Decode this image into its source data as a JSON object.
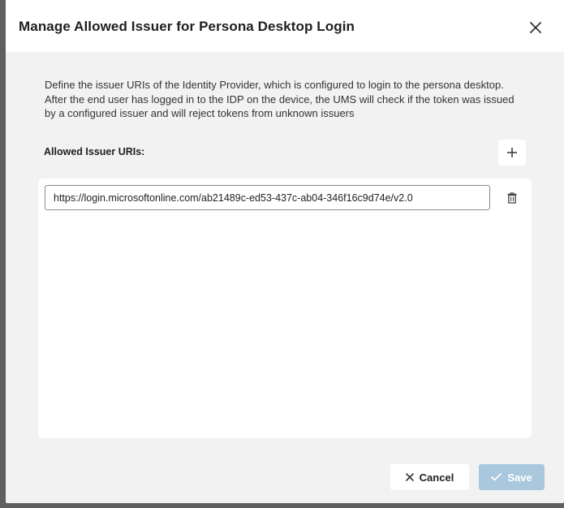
{
  "dialog": {
    "title": "Manage Allowed Issuer for Persona Desktop Login",
    "description": "Define the issuer URIs of the Identity Provider, which is configured to login to the persona desktop. After the end user has logged in to the IDP on the device, the UMS will check if the token was issued by a configured issuer and will reject tokens from unknown issuers",
    "section_label": "Allowed Issuer URIs:",
    "issuers": [
      {
        "value": "https://login.microsoftonline.com/ab21489c-ed53-437c-ab04-346f16c9d74e/v2.0"
      }
    ],
    "icons": {
      "close": "close-icon",
      "add": "plus-icon",
      "delete": "trash-icon",
      "cancel": "x-icon",
      "save": "check-icon"
    }
  },
  "footer": {
    "cancel_label": "Cancel",
    "save_label": "Save"
  },
  "colors": {
    "save_disabled": "#a9c8dd",
    "backdrop": "#5f5f5f"
  }
}
